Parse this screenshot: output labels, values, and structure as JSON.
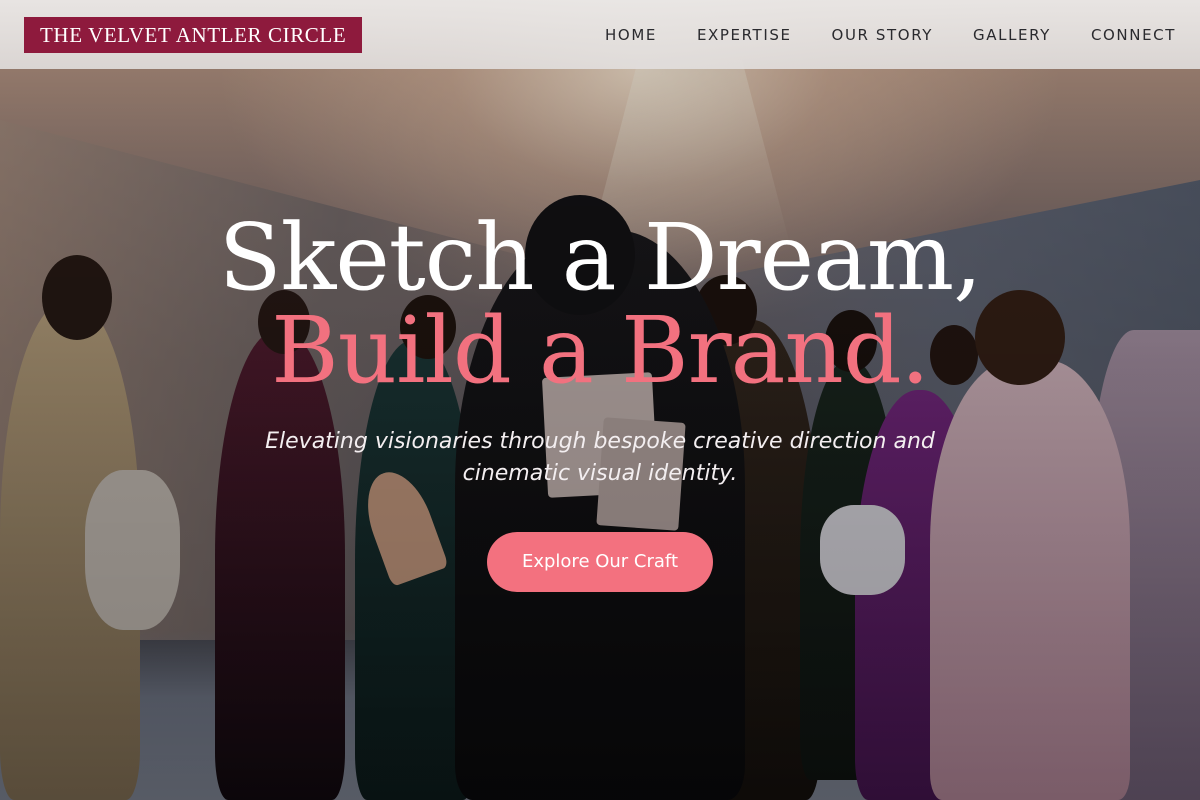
{
  "brand": {
    "logo_text": "THE VELVET ANTLER CIRCLE",
    "logo_bg": "#8e1a3d"
  },
  "nav": {
    "items": [
      {
        "label": "HOME"
      },
      {
        "label": "EXPERTISE"
      },
      {
        "label": "OUR STORY"
      },
      {
        "label": "GALLERY"
      },
      {
        "label": "CONNECT"
      }
    ]
  },
  "hero": {
    "headline_line1": "Sketch a Dream,",
    "headline_line2": "Build a Brand.",
    "subtitle": "Elevating visionaries through bespoke creative direction and cinematic visual identity.",
    "cta_label": "Explore Our Craft",
    "accent_color": "#f2717f",
    "background_image": "fashion-group-photo"
  }
}
